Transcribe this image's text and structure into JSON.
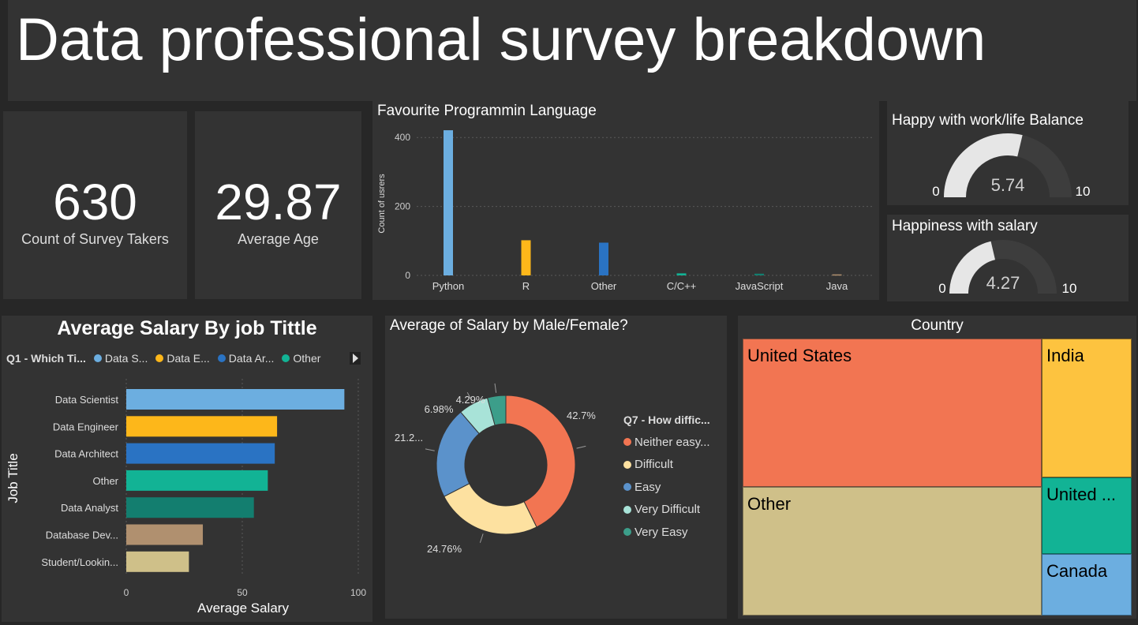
{
  "header": {
    "title": "Data professional survey breakdown"
  },
  "cards": {
    "survey_takers": {
      "value": "630",
      "label": "Count of Survey Takers"
    },
    "average_age": {
      "value": "29.87",
      "label": "Average Age"
    }
  },
  "gauges": {
    "work_life": {
      "title": "Happy with work/life Balance",
      "value": "5.74",
      "min": "0",
      "max": "10",
      "fraction": 0.574
    },
    "salary": {
      "title": "Happiness with salary",
      "value": "4.27",
      "min": "0",
      "max": "10",
      "fraction": 0.427
    }
  },
  "colors": {
    "light_blue": "#6CAEE0",
    "yellow": "#FDB71A",
    "blue": "#2A73C3",
    "teal": "#12B395",
    "dark_teal": "#137E6F",
    "brown": "#B0906F",
    "tan": "#CFC089",
    "orange": "#F27552",
    "cream": "#FDE1A0",
    "mid_blue": "#5B92CB",
    "mint": "#A8E3D8",
    "green_teal": "#3C9E8A"
  },
  "chart_data": [
    {
      "type": "bar",
      "title": "Favourite Programmin Language",
      "ylabel": "Count of usrers",
      "categories": [
        "Python",
        "R",
        "Other",
        "C/C++",
        "JavaScript",
        "Java"
      ],
      "values": [
        421,
        102,
        95,
        6,
        5,
        3
      ],
      "colors": [
        "#6CAEE0",
        "#FDB71A",
        "#2A73C3",
        "#12B395",
        "#137E6F",
        "#B0906F"
      ],
      "yticks": [
        0,
        200,
        400
      ],
      "ylim": [
        0,
        460
      ],
      "grid": true
    },
    {
      "type": "bar",
      "orientation": "horizontal",
      "title": "Average Salary By job Tittle",
      "xlabel": "Average Salary",
      "ylabel": "Job Title",
      "legend_title": "Q1 - Which Ti...",
      "legend": [
        "Data S...",
        "Data E...",
        "Data Ar...",
        "Other"
      ],
      "legend_colors": [
        "#6CAEE0",
        "#FDB71A",
        "#2A73C3",
        "#12B395"
      ],
      "categories": [
        "Data Scientist",
        "Data Engineer",
        "Data Architect",
        "Other",
        "Data Analyst",
        "Database Dev...",
        "Student/Lookin..."
      ],
      "values": [
        94,
        65,
        64,
        61,
        55,
        33,
        27
      ],
      "colors": [
        "#6CAEE0",
        "#FDB71A",
        "#2A73C3",
        "#12B395",
        "#137E6F",
        "#B0906F",
        "#CFC089"
      ],
      "xticks": [
        0,
        50,
        100
      ],
      "xlim": [
        0,
        100
      ],
      "grid": true
    },
    {
      "type": "pie",
      "donut": true,
      "title": "Average of Salary by Male/Female?",
      "legend_title": "Q7 - How diffic...",
      "legend": [
        "Neither easy...",
        "Difficult",
        "Easy",
        "Very Difficult",
        "Very Easy"
      ],
      "values": [
        42.7,
        24.76,
        21.27,
        6.98,
        4.29
      ],
      "labels": [
        "42.7%",
        "24.76%",
        "21.2...",
        "6.98%",
        "4.29%"
      ],
      "colors": [
        "#F27552",
        "#FDE1A0",
        "#5B92CB",
        "#A8E3D8",
        "#3C9E8A"
      ],
      "legend_position": "right"
    },
    {
      "type": "treemap",
      "title": "Country",
      "categories": [
        "United States",
        "Other",
        "India",
        "United ...",
        "Canada"
      ],
      "values": [
        260,
        245,
        80,
        52,
        42
      ],
      "colors": [
        "#F27552",
        "#CFC089",
        "#FDC33F",
        "#12B395",
        "#6CAEE0"
      ]
    }
  ]
}
